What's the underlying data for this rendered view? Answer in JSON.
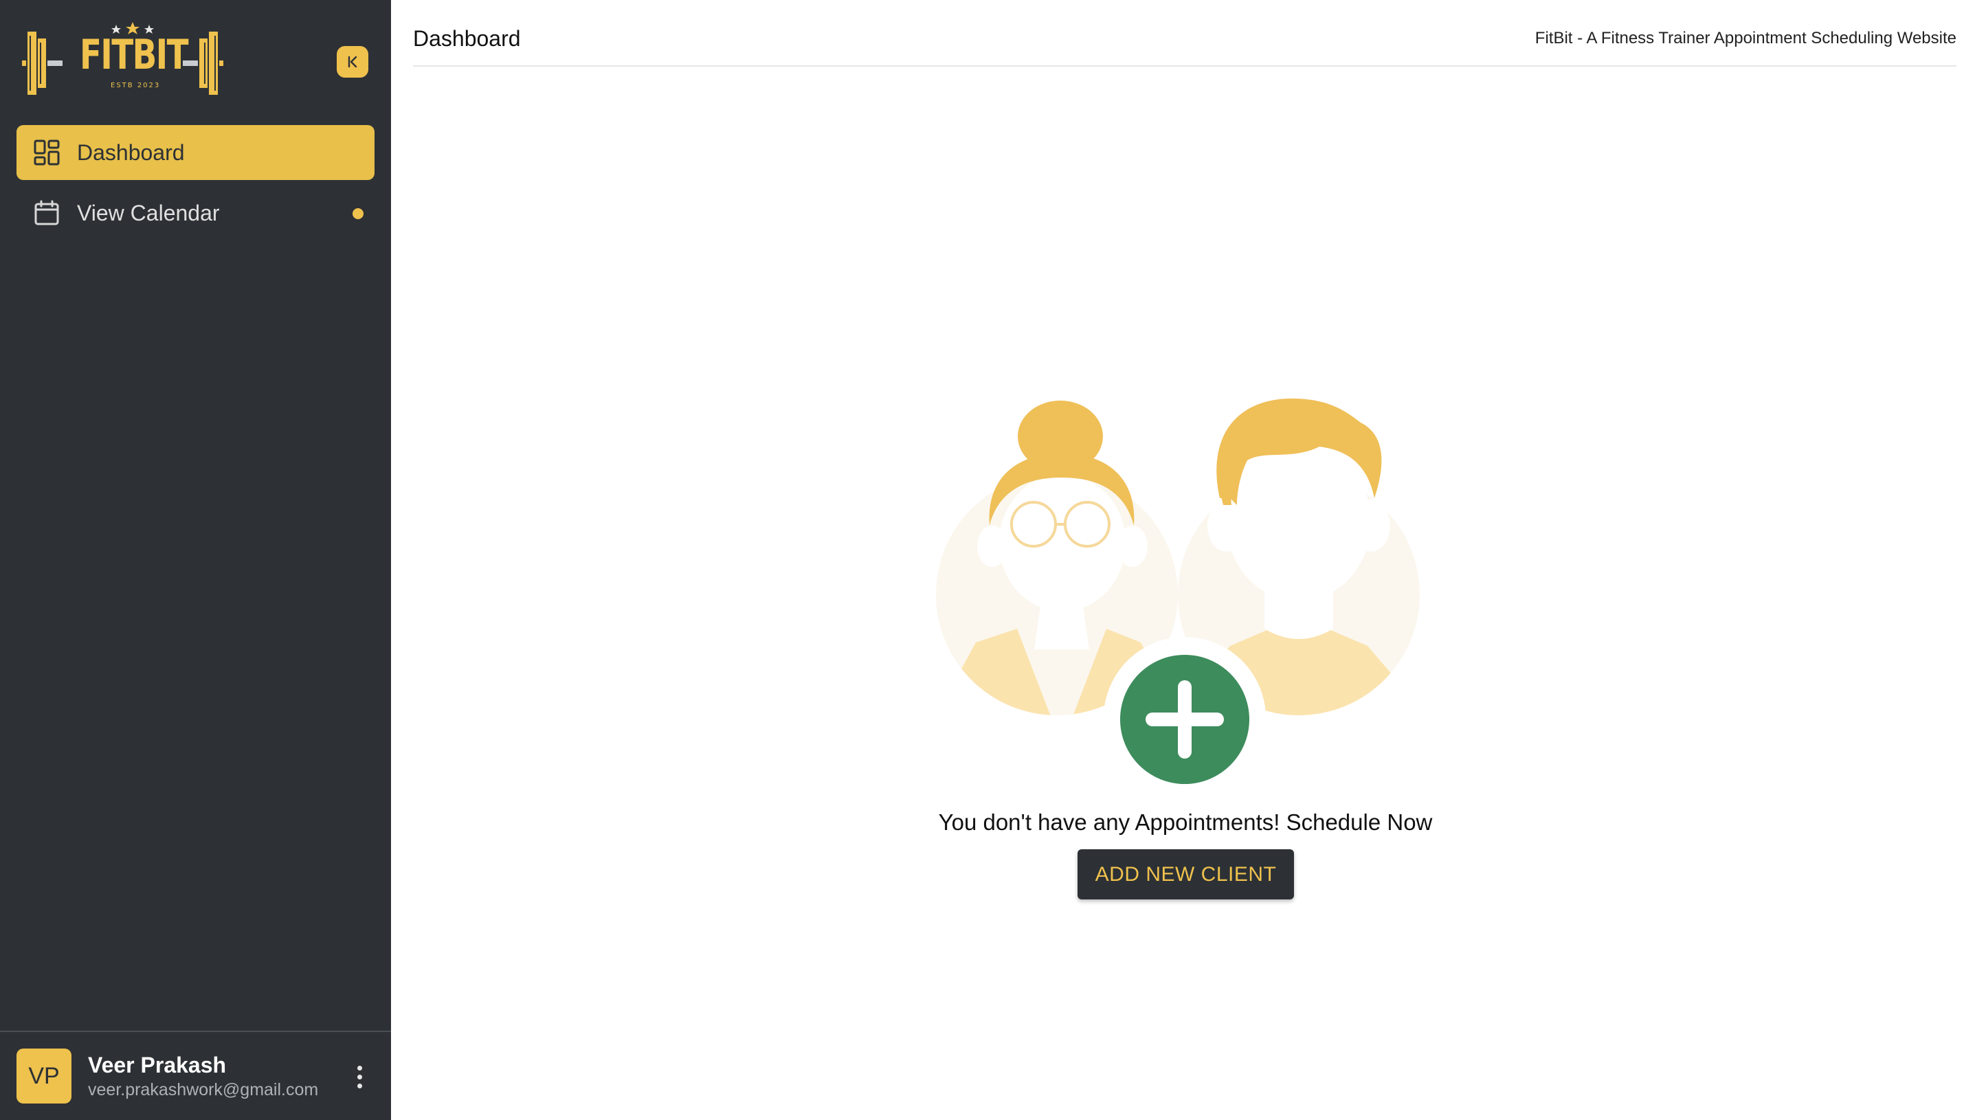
{
  "brand": {
    "logo_text": "FITBIT",
    "logo_subtext": "ESTB 2023",
    "accent_color": "#efc14d",
    "sidebar_color": "#2d3135"
  },
  "sidebar": {
    "collapse_icon": "collapse-left-icon",
    "items": [
      {
        "label": "Dashboard",
        "icon": "dashboard-grid-icon",
        "active": true
      },
      {
        "label": "View Calendar",
        "icon": "calendar-icon",
        "active": false,
        "has_dot": true
      }
    ]
  },
  "user": {
    "initials": "VP",
    "name": "Veer Prakash",
    "email": "veer.prakashwork@gmail.com",
    "menu_icon": "more-vertical-icon"
  },
  "header": {
    "title": "Dashboard",
    "site_title": "FitBit - A Fitness Trainer Appointment Scheduling Website"
  },
  "main": {
    "empty_message": "You don't have any Appointments! Schedule Now",
    "add_button_label": "ADD NEW CLIENT",
    "add_icon_color": "#3d8c5c"
  }
}
